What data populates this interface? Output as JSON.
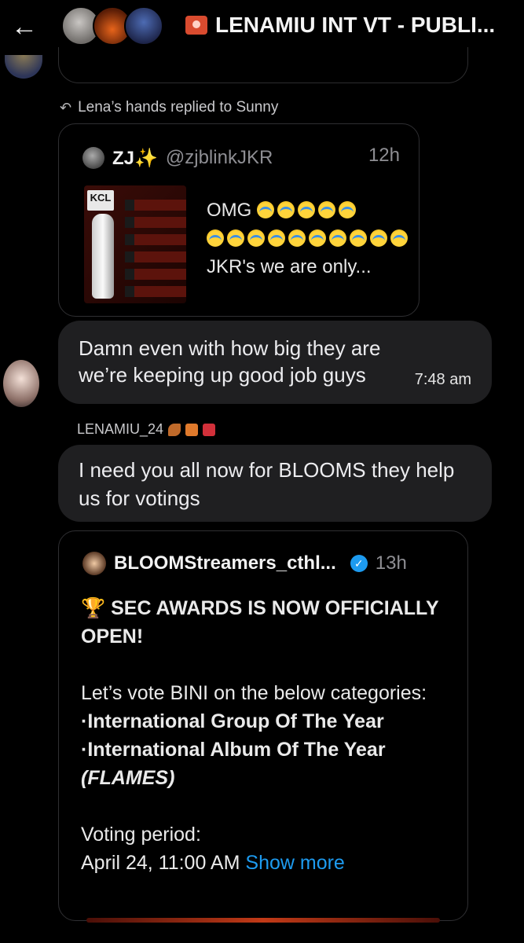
{
  "header": {
    "back_icon": "arrow-left-icon",
    "title": "LENAMIU INT VT - PUBLI...",
    "title_icon": "siren-icon"
  },
  "reply": {
    "icon": "reply-arrow-icon",
    "text": "Lena’s hands replied to Sunny"
  },
  "tweet1": {
    "name": "ZJ✨",
    "handle": "@zjblinkJKR",
    "time": "12h",
    "thumb_label": "KCL",
    "line1": "OMG",
    "line3": "JKR's we are only..."
  },
  "messages": [
    {
      "text": "Damn even with how big they are we’re keeping up good job guys",
      "time": "7:48 am"
    },
    {
      "sender": "LENAMIU_24",
      "text": "I need you all now for BLOOMS they help us for votings"
    }
  ],
  "tweet2": {
    "name": "BLOOMStreamers_cthl...",
    "time": "13h",
    "headline": "SEC AWARDS IS NOW OFFICIALLY OPEN!",
    "intro": "Let’s vote BINI on the below categories:",
    "cat1": "·International Group Of The Year",
    "cat2": "·International Album Of The Year",
    "cat2_note": "(FLAMES)",
    "period_label": "Voting period:",
    "period_value": "April 24, 11:00 AM",
    "show_more": "Show more"
  },
  "colors": {
    "background": "#000000",
    "bubble": "#1f1f21",
    "link": "#1d9bf0"
  }
}
